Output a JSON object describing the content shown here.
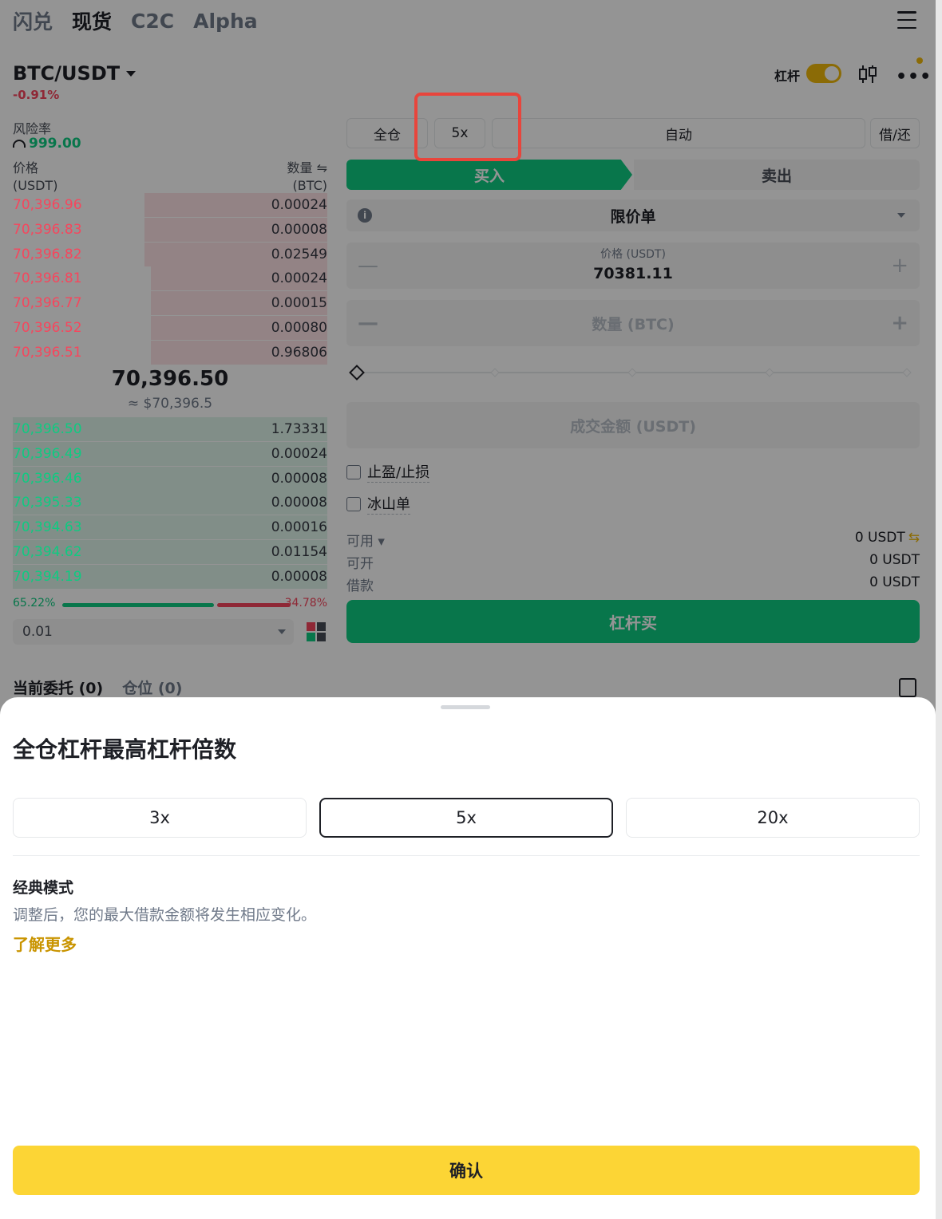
{
  "nav": {
    "tabs": [
      "闪兑",
      "现货",
      "C2C",
      "Alpha"
    ]
  },
  "pair": {
    "symbol": "BTC/USDT",
    "change": "-0.91%"
  },
  "header": {
    "leverage_label": "杠杆"
  },
  "risk": {
    "label": "风险率",
    "value": "999.00"
  },
  "orderbook": {
    "price_header": "价格",
    "price_unit": "(USDT)",
    "qty_header": "数量 ⇋",
    "qty_unit": "(BTC)",
    "asks": [
      {
        "price": "70,396.96",
        "qty": "0.00024",
        "depth": 0.58
      },
      {
        "price": "70,396.83",
        "qty": "0.00008",
        "depth": 0.58
      },
      {
        "price": "70,396.82",
        "qty": "0.02549",
        "depth": 0.58
      },
      {
        "price": "70,396.81",
        "qty": "0.00024",
        "depth": 0.56
      },
      {
        "price": "70,396.77",
        "qty": "0.00015",
        "depth": 0.56
      },
      {
        "price": "70,396.52",
        "qty": "0.00080",
        "depth": 0.56
      },
      {
        "price": "70,396.51",
        "qty": "0.96806",
        "depth": 0.56
      }
    ],
    "mid_price": "70,396.50",
    "mid_usd": "≈ $70,396.5",
    "bids": [
      {
        "price": "70,396.50",
        "qty": "1.73331",
        "depth": 1.0
      },
      {
        "price": "70,396.49",
        "qty": "0.00024",
        "depth": 1.0
      },
      {
        "price": "70,396.46",
        "qty": "0.00008",
        "depth": 1.0
      },
      {
        "price": "70,395.33",
        "qty": "0.00008",
        "depth": 1.0
      },
      {
        "price": "70,394.63",
        "qty": "0.00016",
        "depth": 1.0
      },
      {
        "price": "70,394.62",
        "qty": "0.01154",
        "depth": 1.0
      },
      {
        "price": "70,394.19",
        "qty": "0.00008",
        "depth": 1.0
      }
    ],
    "buy_ratio": "65.22%",
    "sell_ratio": "34.78%",
    "precision": "0.01"
  },
  "trade": {
    "margin_mode": "全仓",
    "leverage": "5x",
    "borrow_mode": "自动",
    "borrow_repay": "借/还",
    "buy_tab": "买入",
    "sell_tab": "卖出",
    "order_type": "限价单",
    "price_label": "价格 (USDT)",
    "price_value": "70381.11",
    "qty_placeholder": "数量 (BTC)",
    "total_placeholder": "成交金额 (USDT)",
    "tp_sl": "止盈/止损",
    "iceberg": "冰山单",
    "available_label": "可用 ▾",
    "available_value": "0 USDT",
    "openable_label": "可开",
    "openable_value": "0 USDT",
    "borrow_label": "借款",
    "borrow_value": "0 USDT",
    "submit": "杠杆买"
  },
  "bottom_tabs": {
    "orders": "当前委托 (0)",
    "positions": "仓位 (0)"
  },
  "sheet": {
    "title": "全仓杠杆最高杠杆倍数",
    "options": [
      "3x",
      "5x",
      "20x"
    ],
    "selected": "5x",
    "mode_title": "经典模式",
    "mode_desc": "调整后，您的最大借款金额将发生相应变化。",
    "learn_more": "了解更多",
    "confirm": "确认"
  },
  "colors": {
    "buy": "#0ecb81",
    "sell": "#f6465d",
    "brand": "#fcd535",
    "accent": "#f0b90b"
  }
}
